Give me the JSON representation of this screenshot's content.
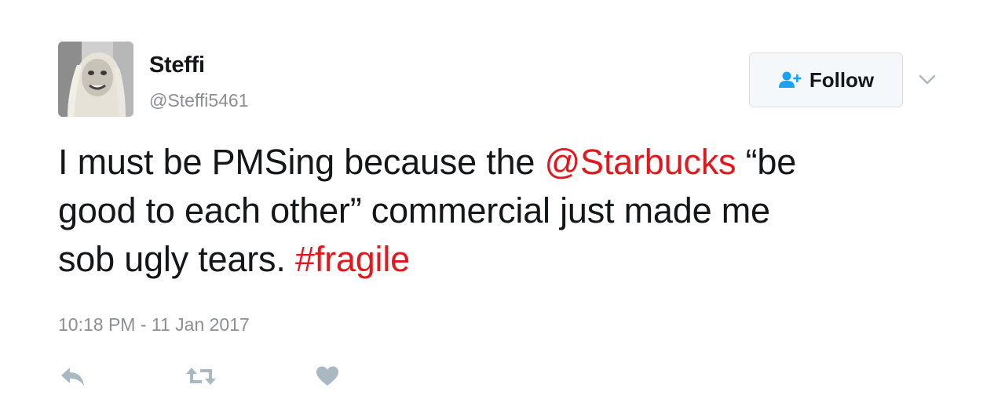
{
  "user": {
    "display_name": "Steffi",
    "handle": "@Steffi5461",
    "avatar_icon": "user-avatar-photo"
  },
  "follow": {
    "label": "Follow",
    "icon": "add-user-icon"
  },
  "menu": {
    "icon": "chevron-down-icon"
  },
  "tweet": {
    "line1_a": "I must be PMSing because the ",
    "mention": "@Starbucks",
    "line1_b": " “be",
    "line2": "good to each other” commercial just made me",
    "line3_a": "sob ugly tears. ",
    "hashtag": "#fragile"
  },
  "timestamp": "10:18 PM - 11 Jan 2017",
  "actions": [
    {
      "name": "reply",
      "icon": "reply-icon"
    },
    {
      "name": "retweet",
      "icon": "retweet-icon"
    },
    {
      "name": "like",
      "icon": "heart-icon"
    }
  ],
  "colors": {
    "link": "#e0191e",
    "text": "#14171a",
    "muted": "#8a8f94",
    "follow_icon": "#1da1f2",
    "action_icon": "#aab8c2"
  }
}
